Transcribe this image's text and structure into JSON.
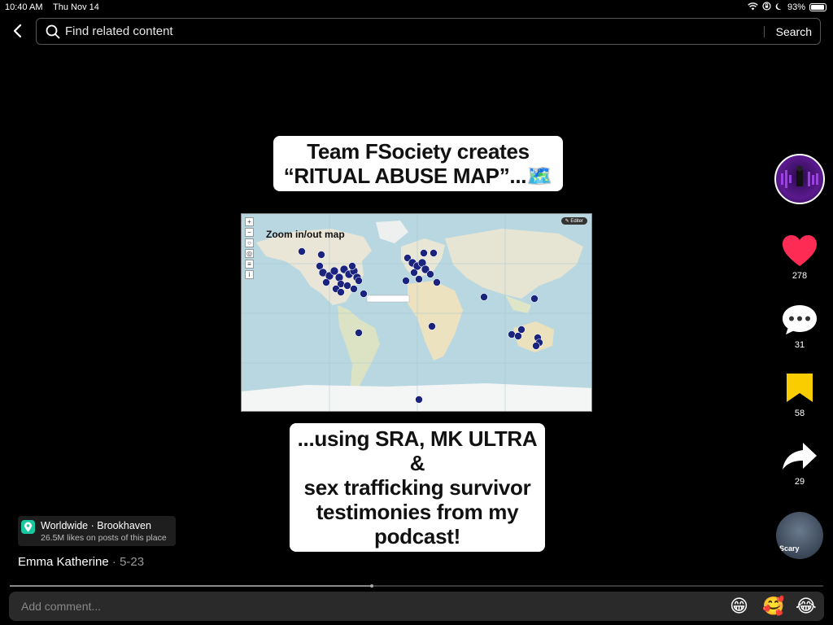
{
  "status_bar": {
    "time": "10:40 AM",
    "date": "Thu Nov 14",
    "battery": "93%",
    "battery_level": 0.93
  },
  "search": {
    "placeholder": "Find related content",
    "button": "Search"
  },
  "captions": {
    "top_line1": "Team FSociety creates",
    "top_line2": "“RITUAL ABUSE MAP”...",
    "top_emoji": "🗺️",
    "bottom_line1": "...using SRA, MK ULTRA &",
    "bottom_line2": "sex trafficking survivor",
    "bottom_line3": "testimonies from my",
    "bottom_line4": "podcast!"
  },
  "map": {
    "label": "Zoom in/out map",
    "edit_label": "✎ Editer"
  },
  "rail": {
    "likes": "278",
    "comments": "31",
    "saves": "58",
    "shares": "29",
    "sound_label": "Scary",
    "colors": {
      "like": "#fe2c55",
      "save": "#facd00"
    }
  },
  "location": {
    "title": "Worldwide · Brookhaven",
    "subtitle": "26.5M likes on posts of this place"
  },
  "author": {
    "name": "Emma Katherine",
    "date": "5-23"
  },
  "progress": {
    "fraction": 0.445
  },
  "comment": {
    "placeholder": "Add comment...",
    "emojis": [
      "😁",
      "🥰",
      "😂"
    ]
  }
}
